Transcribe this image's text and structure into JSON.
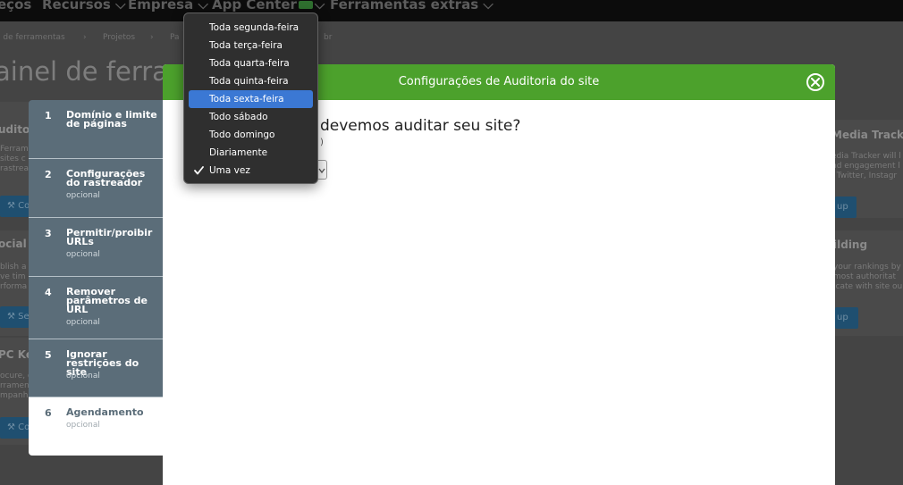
{
  "top_nav": {
    "items": [
      "eços",
      "Recursos",
      "Empresa",
      "App Center",
      "Ferramentas extras"
    ]
  },
  "breadcrumb": {
    "items": [
      "l de ferramentas",
      "Projetos",
      "Pa",
      "br"
    ]
  },
  "page_title": "ainel de ferram",
  "background_cards": {
    "left": [
      {
        "title": "uditor",
        "lines": [
          "Ferram",
          "sites c",
          "rastreab"
        ],
        "button": "Con"
      },
      {
        "title": "ocial M",
        "lines": [
          "blish a",
          "ve tim",
          "rforma"
        ],
        "button": "Set"
      },
      {
        "title": "PC Ke",
        "lines": [
          "ocure, c",
          "rramen",
          "mpanh"
        ],
        "button": "Con"
      }
    ],
    "right": [
      {
        "title": "Media Tracker",
        "lines": [
          "edia Tracker will l",
          "nd engagement l",
          ", Twitter, Instagr"
        ],
        "button": "up"
      },
      {
        "title": "ilding",
        "lines": [
          "your rankings by",
          "most authoritat",
          "icate with site ou"
        ],
        "button": "up"
      }
    ]
  },
  "modal": {
    "title": "Configurações de Auditoria do site",
    "question": "devemos auditar seu site?",
    "paren_text": ")",
    "steps": [
      {
        "num": "1",
        "label": "Domínio e limite de páginas",
        "optional": ""
      },
      {
        "num": "2",
        "label": "Configurações do rastreador",
        "optional": "opcional"
      },
      {
        "num": "3",
        "label": "Permitir/proibir URLs",
        "optional": "opcional"
      },
      {
        "num": "4",
        "label": "Remover parâmetros de URL",
        "optional": "opcional"
      },
      {
        "num": "5",
        "label": "Ignorar restrições do site",
        "optional": "opcional"
      },
      {
        "num": "6",
        "label": "Agendamento",
        "optional": "opcional"
      }
    ]
  },
  "schedule_dropdown": {
    "options": [
      "Toda segunda-feira",
      "Toda terça-feira",
      "Toda quarta-feira",
      "Toda quinta-feira",
      "Toda sexta-feira",
      "Todo sábado",
      "Todo domingo",
      "Diariamente",
      "Uma vez"
    ],
    "highlighted_index": 4,
    "selected_value": "Uma vez",
    "highlight_color": "#3b78d4"
  },
  "colors": {
    "header_green": "#4ca12c",
    "sidebar_slate": "#5b6d79"
  }
}
